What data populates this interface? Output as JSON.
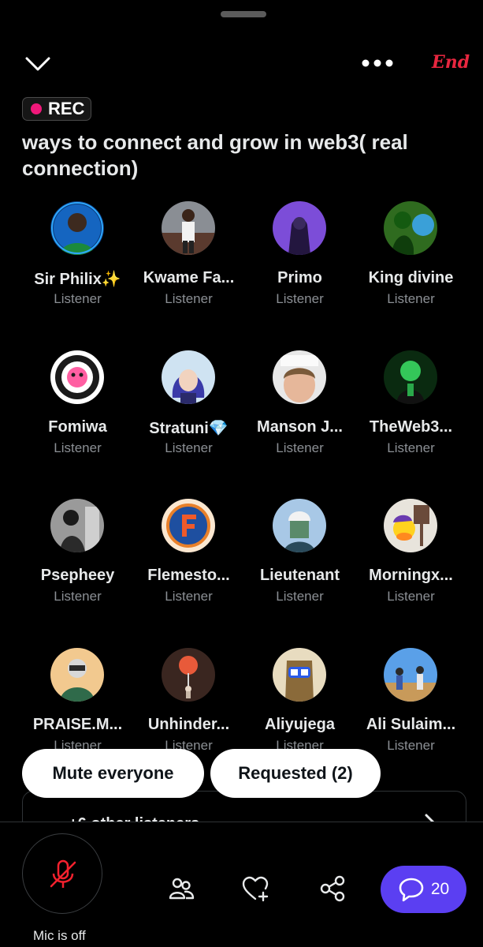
{
  "header": {
    "end_label": "End",
    "rec_label": "REC",
    "title": "ways to connect and grow in web3( real connection)"
  },
  "participants": [
    {
      "name": "Sir Philix✨",
      "role": "Listener"
    },
    {
      "name": "Kwame Fa...",
      "role": "Listener"
    },
    {
      "name": "Primo",
      "role": "Listener"
    },
    {
      "name": "King divine",
      "role": "Listener"
    },
    {
      "name": "Fomiwa",
      "role": "Listener"
    },
    {
      "name": "Stratuni💎",
      "role": "Listener"
    },
    {
      "name": "Manson J...",
      "role": "Listener"
    },
    {
      "name": "TheWeb3...",
      "role": "Listener"
    },
    {
      "name": "Psepheey",
      "role": "Listener"
    },
    {
      "name": "Flemesto...",
      "role": "Listener"
    },
    {
      "name": "Lieutenant",
      "role": "Listener"
    },
    {
      "name": "Morningx...",
      "role": "Listener"
    },
    {
      "name": "PRAISE.M...",
      "role": "Listener"
    },
    {
      "name": "Unhinder...",
      "role": "Listener"
    },
    {
      "name": "Aliyujega",
      "role": "Listener"
    },
    {
      "name": "Ali Sulaim...",
      "role": "Listener"
    }
  ],
  "actions": {
    "mute_everyone": "Mute everyone",
    "requested": "Requested (2)"
  },
  "others_card": {
    "label": "+6 other listeners"
  },
  "bottom_bar": {
    "mic_label": "Mic is off",
    "chat_count": "20"
  },
  "icons": [
    "chevron-down-icon",
    "more-icon",
    "mic-off-icon",
    "people-icon",
    "heart-plus-icon",
    "share-icon",
    "chat-icon"
  ],
  "colors": {
    "accent": "#5b3ff2",
    "rec": "#f0187a",
    "end": "#e8263f",
    "mic_off": "#f4212e"
  }
}
